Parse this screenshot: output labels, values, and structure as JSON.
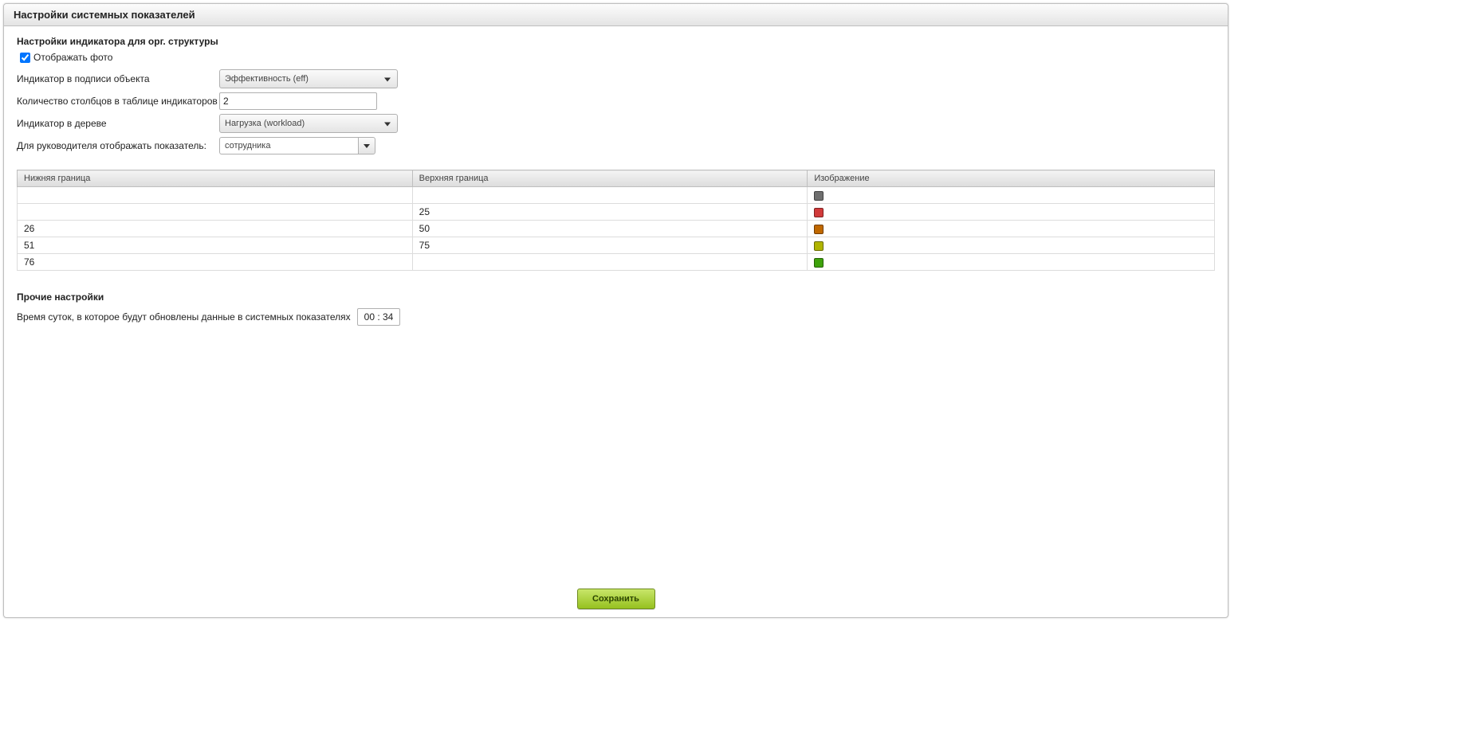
{
  "window": {
    "title": "Настройки системных показателей"
  },
  "section1": {
    "title": "Настройки индикатора для орг. структуры",
    "show_photo": {
      "label": "Отображать фото",
      "checked": true
    },
    "indicator_caption": {
      "label": "Индикатор в подписи объекта",
      "value": "Эффективность (eff)"
    },
    "columns_count": {
      "label": "Количество столбцов в таблице индикаторов",
      "value": "2"
    },
    "indicator_tree": {
      "label": "Индикатор в дереве",
      "value": "Нагрузка (workload)"
    },
    "leader_metric": {
      "label": "Для руководителя отображать показатель:",
      "value": "сотрудника"
    }
  },
  "table": {
    "headers": {
      "lower": "Нижняя граница",
      "upper": "Верхняя граница",
      "image": "Изображение"
    },
    "rows": [
      {
        "lower": "",
        "upper": "",
        "color": "#6f6f6f"
      },
      {
        "lower": "",
        "upper": "25",
        "color": "#d13a3a"
      },
      {
        "lower": "26",
        "upper": "50",
        "color": "#c06800"
      },
      {
        "lower": "51",
        "upper": "75",
        "color": "#b0b400"
      },
      {
        "lower": "76",
        "upper": "",
        "color": "#3ea20b"
      }
    ]
  },
  "other": {
    "title": "Прочие настройки",
    "time": {
      "label": "Время суток, в которое будут обновлены данные в системных показателях",
      "value": "00 : 34"
    }
  },
  "footer": {
    "save": "Сохранить"
  }
}
